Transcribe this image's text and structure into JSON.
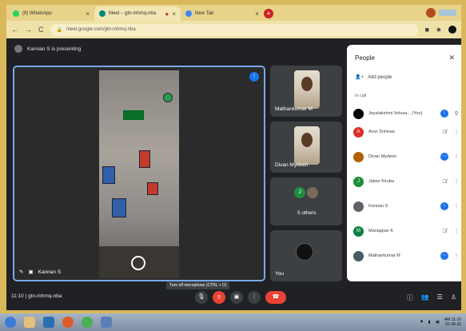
{
  "browser": {
    "tabs": [
      {
        "label": "(8) WhatsApp"
      },
      {
        "label": "Meet – gtn-mhmq-nba"
      },
      {
        "label": "New Tab"
      }
    ],
    "url": "meet.google.com/gtn-mhmq-nba"
  },
  "meet": {
    "presenting_label": "Kannan S is presenting",
    "main_tile_name": "Kannan S",
    "tiles": [
      {
        "label": "Mathankumar M"
      },
      {
        "label": "Divan Mydeen"
      },
      {
        "label": "5 others"
      },
      {
        "label": "You"
      }
    ],
    "others_avatar_letter": "J"
  },
  "people_panel": {
    "title": "People",
    "add_people": "Add people",
    "section": "In call",
    "people": [
      {
        "name": "Jeyalakshmi Velusa...  (You)",
        "initial": "",
        "color": "#000000",
        "status": "speaking"
      },
      {
        "name": "Arun Srinivas",
        "initial": "A",
        "color": "#d93025",
        "status": "muted"
      },
      {
        "name": "Divan Mydeen",
        "initial": "",
        "color": "#b06000",
        "status": "speaking"
      },
      {
        "name": "Jabez Kiruba",
        "initial": "J",
        "color": "#1e8e3e",
        "status": "muted"
      },
      {
        "name": "Kannan S",
        "initial": "",
        "color": "#5f6368",
        "status": "active"
      },
      {
        "name": "Mariappan K",
        "initial": "M",
        "color": "#0b8043",
        "status": "muted"
      },
      {
        "name": "Mathankumar M",
        "initial": "",
        "color": "#455a64",
        "status": "speaking"
      }
    ]
  },
  "controls": {
    "time": "11:10",
    "meeting_code": "gtn-mhmq-nba",
    "tooltip": "Turn off microphone (CTRL + D)"
  },
  "taskbar": {
    "time": "AM 11:10",
    "date": "02-08-20"
  }
}
